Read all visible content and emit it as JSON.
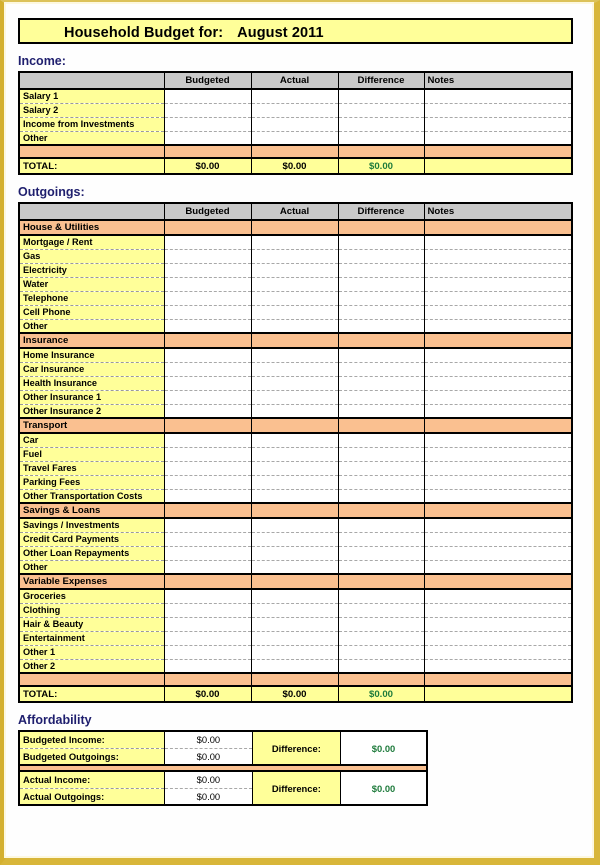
{
  "document": {
    "title_prefix": "Household Budget for:",
    "title_period": "August 2011"
  },
  "colors": {
    "title_bg": "#FFFF99",
    "header_bg": "#C9C9C9",
    "label_bg": "#FFFF99",
    "category_bg": "#FAC090",
    "total_bg": "#FFFF99",
    "section_label": "#1F1F6E",
    "positive_value": "#1E7B3C",
    "page_border": "#D4B030"
  },
  "columns": {
    "label": "",
    "budgeted": "Budgeted",
    "actual": "Actual",
    "difference": "Difference",
    "notes": "Notes"
  },
  "income": {
    "section_label": "Income:",
    "rows": [
      {
        "label": "Salary 1",
        "budgeted": "",
        "actual": "",
        "difference": "",
        "notes": ""
      },
      {
        "label": "Salary 2",
        "budgeted": "",
        "actual": "",
        "difference": "",
        "notes": ""
      },
      {
        "label": "Income from Investments",
        "budgeted": "",
        "actual": "",
        "difference": "",
        "notes": ""
      },
      {
        "label": "Other",
        "budgeted": "",
        "actual": "",
        "difference": "",
        "notes": ""
      }
    ],
    "total": {
      "label": "TOTAL:",
      "budgeted": "$0.00",
      "actual": "$0.00",
      "difference": "$0.00",
      "notes": ""
    }
  },
  "outgoings": {
    "section_label": "Outgoings:",
    "categories": [
      {
        "name": "House & Utilities",
        "rows": [
          {
            "label": "Mortgage / Rent",
            "budgeted": "",
            "actual": "",
            "difference": "",
            "notes": ""
          },
          {
            "label": "Gas",
            "budgeted": "",
            "actual": "",
            "difference": "",
            "notes": ""
          },
          {
            "label": "Electricity",
            "budgeted": "",
            "actual": "",
            "difference": "",
            "notes": ""
          },
          {
            "label": "Water",
            "budgeted": "",
            "actual": "",
            "difference": "",
            "notes": ""
          },
          {
            "label": "Telephone",
            "budgeted": "",
            "actual": "",
            "difference": "",
            "notes": ""
          },
          {
            "label": "Cell Phone",
            "budgeted": "",
            "actual": "",
            "difference": "",
            "notes": ""
          },
          {
            "label": "Other",
            "budgeted": "",
            "actual": "",
            "difference": "",
            "notes": ""
          }
        ]
      },
      {
        "name": "Insurance",
        "rows": [
          {
            "label": "Home Insurance",
            "budgeted": "",
            "actual": "",
            "difference": "",
            "notes": ""
          },
          {
            "label": "Car Insurance",
            "budgeted": "",
            "actual": "",
            "difference": "",
            "notes": ""
          },
          {
            "label": "Health Insurance",
            "budgeted": "",
            "actual": "",
            "difference": "",
            "notes": ""
          },
          {
            "label": "Other Insurance 1",
            "budgeted": "",
            "actual": "",
            "difference": "",
            "notes": ""
          },
          {
            "label": "Other Insurance 2",
            "budgeted": "",
            "actual": "",
            "difference": "",
            "notes": ""
          }
        ]
      },
      {
        "name": "Transport",
        "rows": [
          {
            "label": "Car",
            "budgeted": "",
            "actual": "",
            "difference": "",
            "notes": ""
          },
          {
            "label": "Fuel",
            "budgeted": "",
            "actual": "",
            "difference": "",
            "notes": ""
          },
          {
            "label": "Travel Fares",
            "budgeted": "",
            "actual": "",
            "difference": "",
            "notes": ""
          },
          {
            "label": "Parking Fees",
            "budgeted": "",
            "actual": "",
            "difference": "",
            "notes": ""
          },
          {
            "label": "Other Transportation Costs",
            "budgeted": "",
            "actual": "",
            "difference": "",
            "notes": ""
          }
        ]
      },
      {
        "name": "Savings & Loans",
        "rows": [
          {
            "label": "Savings / Investments",
            "budgeted": "",
            "actual": "",
            "difference": "",
            "notes": ""
          },
          {
            "label": "Credit Card Payments",
            "budgeted": "",
            "actual": "",
            "difference": "",
            "notes": ""
          },
          {
            "label": "Other Loan Repayments",
            "budgeted": "",
            "actual": "",
            "difference": "",
            "notes": ""
          },
          {
            "label": "Other",
            "budgeted": "",
            "actual": "",
            "difference": "",
            "notes": ""
          }
        ]
      },
      {
        "name": "Variable Expenses",
        "rows": [
          {
            "label": "Groceries",
            "budgeted": "",
            "actual": "",
            "difference": "",
            "notes": ""
          },
          {
            "label": "Clothing",
            "budgeted": "",
            "actual": "",
            "difference": "",
            "notes": ""
          },
          {
            "label": "Hair & Beauty",
            "budgeted": "",
            "actual": "",
            "difference": "",
            "notes": ""
          },
          {
            "label": "Entertainment",
            "budgeted": "",
            "actual": "",
            "difference": "",
            "notes": ""
          },
          {
            "label": "Other 1",
            "budgeted": "",
            "actual": "",
            "difference": "",
            "notes": ""
          },
          {
            "label": "Other 2",
            "budgeted": "",
            "actual": "",
            "difference": "",
            "notes": ""
          }
        ]
      }
    ],
    "total": {
      "label": "TOTAL:",
      "budgeted": "$0.00",
      "actual": "$0.00",
      "difference": "$0.00",
      "notes": ""
    }
  },
  "affordability": {
    "section_label": "Affordability",
    "blocks": [
      {
        "rows": [
          {
            "label": "Budgeted Income:",
            "value": "$0.00"
          },
          {
            "label": "Budgeted Outgoings:",
            "value": "$0.00"
          }
        ],
        "difference_label": "Difference:",
        "difference_value": "$0.00"
      },
      {
        "rows": [
          {
            "label": "Actual Income:",
            "value": "$0.00"
          },
          {
            "label": "Actual Outgoings:",
            "value": "$0.00"
          }
        ],
        "difference_label": "Difference:",
        "difference_value": "$0.00"
      }
    ]
  }
}
